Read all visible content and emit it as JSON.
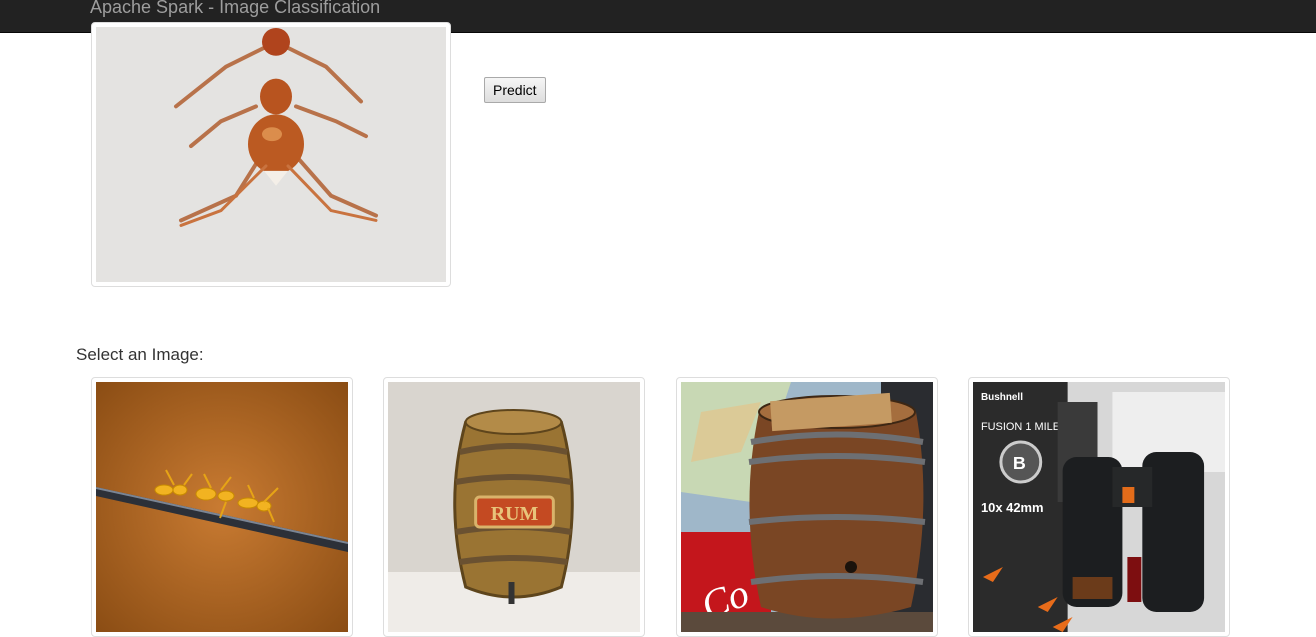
{
  "navbar": {
    "brand": "Apache Spark - Image Classification"
  },
  "preview": {
    "icon": "ant-closeup-image"
  },
  "actions": {
    "predict_label": "Predict"
  },
  "gallery": {
    "label": "Select an Image:",
    "images": [
      {
        "icon": "ants-on-wire-image"
      },
      {
        "icon": "rum-barrel-image",
        "sign_text": "RUM"
      },
      {
        "icon": "wine-barrel-image"
      },
      {
        "icon": "binoculars-image",
        "brand_text": "Bushnell",
        "spec_text": "10x 42mm"
      }
    ]
  }
}
